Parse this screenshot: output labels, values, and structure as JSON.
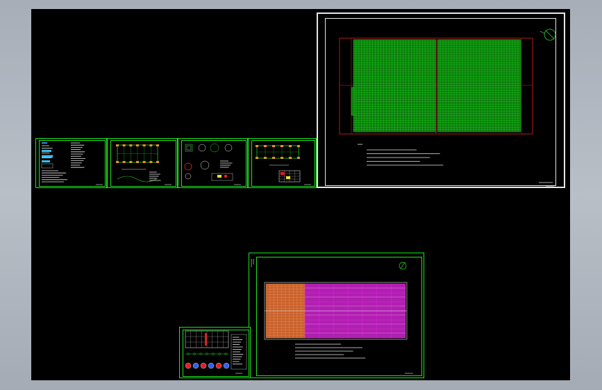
{
  "viewport": {
    "background": "#000000",
    "window_background": "#b0b6be"
  },
  "colors": {
    "sheet_border": "#1ee61e",
    "frame_white": "#e8e8e8",
    "grid_green": "#20e020",
    "grid_red": "#e02020",
    "magenta": "#e020e0",
    "orange": "#e08020",
    "yellow": "#f0e020"
  },
  "icons": [
    "north-arrow-icon"
  ],
  "sheets": [
    {
      "id": "main-floor-plan",
      "style": "white-frame",
      "content": "green-grid-plan"
    },
    {
      "id": "notes-sheet",
      "style": "green-frame",
      "content": "text-notes"
    },
    {
      "id": "foundation-plan",
      "style": "green-frame",
      "content": "plan-and-sections"
    },
    {
      "id": "details-sheet",
      "style": "green-frame",
      "content": "detail-drawings"
    },
    {
      "id": "column-plan",
      "style": "green-frame",
      "content": "plan-and-table"
    },
    {
      "id": "colored-plan",
      "style": "green-frame",
      "content": "magenta-orange-grid-plan"
    },
    {
      "id": "small-detail-sheet",
      "style": "green-frame",
      "content": "sections-and-symbols"
    }
  ]
}
